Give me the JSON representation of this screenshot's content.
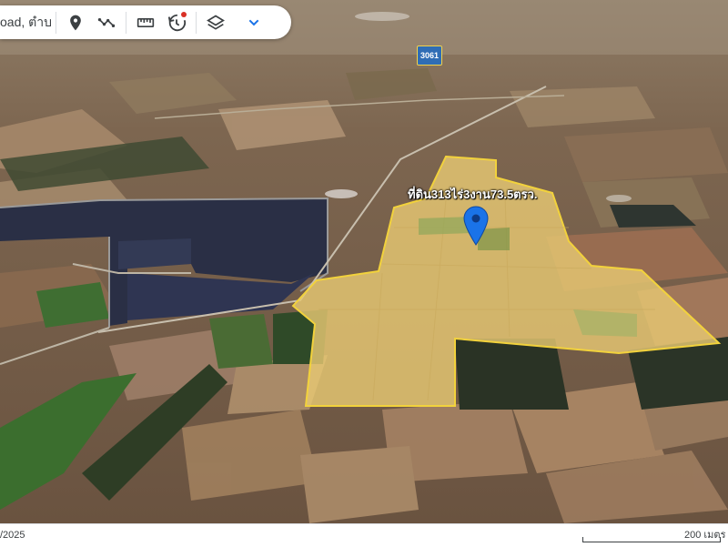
{
  "toolbar": {
    "search_value": "Road, ตำบ",
    "buttons": [
      {
        "icon": "location-pin-icon"
      },
      {
        "icon": "path-icon"
      },
      {
        "icon": "ruler-icon"
      },
      {
        "icon": "historical-imagery-icon"
      },
      {
        "icon": "layers-icon"
      },
      {
        "icon": "chevron-down-icon"
      }
    ],
    "accent_color": "#1a73e8",
    "notification_dot_color": "#d93025"
  },
  "map": {
    "route_shield": "3061",
    "parcel_label": "ที่ดิน313ไร่3งาน73.5ตรว.",
    "parcel_outline_color": "#f2d23c",
    "pin_color": "#1a73e8"
  },
  "status_bar": {
    "date_text": "/2025",
    "scale_text": "200 เมตร"
  }
}
